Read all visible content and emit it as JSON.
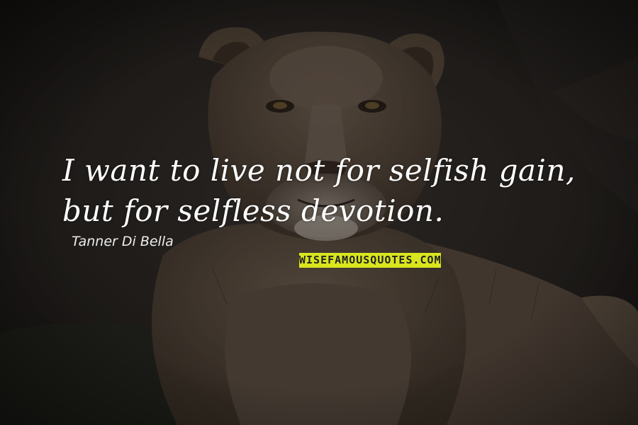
{
  "quote": {
    "text": "I want to live not for selfish gain, but for selfless devotion.",
    "author": "Tanner Di Bella"
  },
  "watermark": {
    "text": "WISEFAMOUSQUOTES.COM",
    "background": "#d9e61e",
    "color": "#222222"
  },
  "photo": {
    "subject": "lioness-photo",
    "text_color": "#ffffff"
  }
}
